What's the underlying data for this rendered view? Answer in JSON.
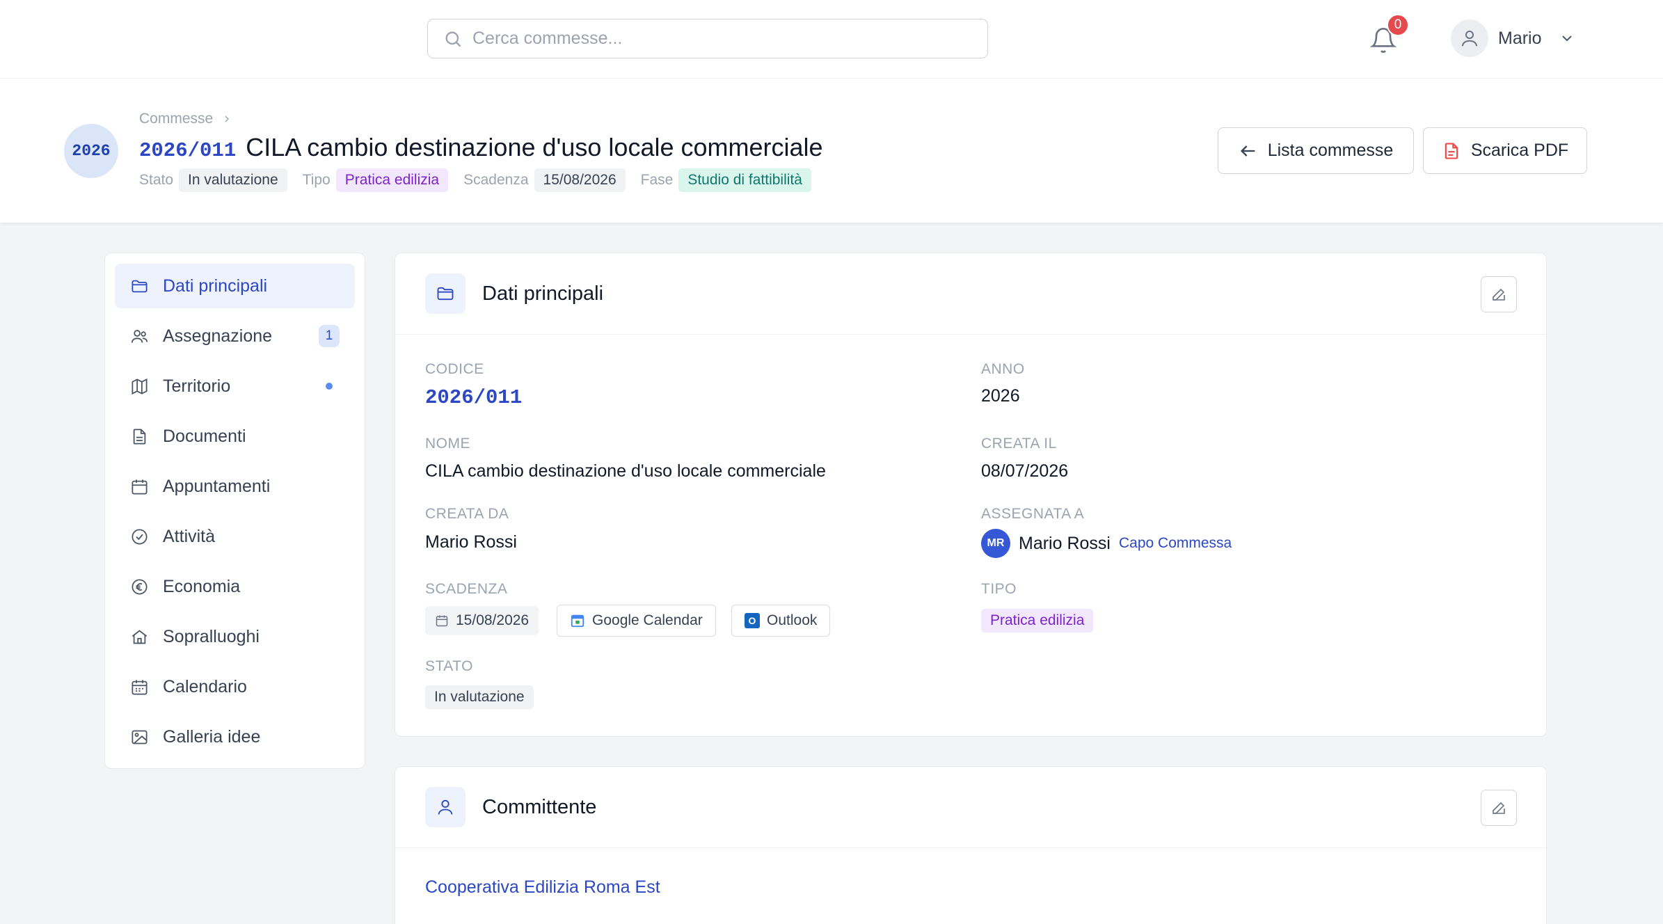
{
  "topbar": {
    "search_placeholder": "Cerca commesse...",
    "notifications_count": "0",
    "user_name": "Mario"
  },
  "header": {
    "year_badge": "2026",
    "breadcrumb": "Commesse",
    "code": "2026/011",
    "title": "CILA cambio destinazione d'uso locale commerciale",
    "meta": {
      "stato_label": "Stato",
      "stato_value": "In valutazione",
      "tipo_label": "Tipo",
      "tipo_value": "Pratica edilizia",
      "scadenza_label": "Scadenza",
      "scadenza_value": "15/08/2026",
      "fase_label": "Fase",
      "fase_value": "Studio di fattibilità"
    },
    "list_button": "Lista commesse",
    "pdf_button": "Scarica PDF"
  },
  "sidebar": {
    "items": [
      {
        "label": "Dati principali",
        "icon": "folder-icon"
      },
      {
        "label": "Assegnazione",
        "icon": "users-icon",
        "badge": "1"
      },
      {
        "label": "Territorio",
        "icon": "map-icon"
      },
      {
        "label": "Documenti",
        "icon": "document-icon"
      },
      {
        "label": "Appuntamenti",
        "icon": "calendar-icon"
      },
      {
        "label": "Attività",
        "icon": "check-circle-icon"
      },
      {
        "label": "Economia",
        "icon": "euro-icon"
      },
      {
        "label": "Sopralluoghi",
        "icon": "home-icon"
      },
      {
        "label": "Calendario",
        "icon": "calendar-grid-icon"
      },
      {
        "label": "Galleria idee",
        "icon": "image-icon"
      }
    ]
  },
  "main_card": {
    "title": "Dati principali",
    "codice_label": "CODICE",
    "codice_value": "2026/011",
    "anno_label": "ANNO",
    "anno_value": "2026",
    "nome_label": "NOME",
    "nome_value": "CILA cambio destinazione d'uso locale commerciale",
    "creata_il_label": "CREATA IL",
    "creata_il_value": "08/07/2026",
    "creata_da_label": "CREATA DA",
    "creata_da_value": "Mario Rossi",
    "assegnata_label": "ASSEGNATA A",
    "assegnata_initials": "MR",
    "assegnata_name": "Mario Rossi",
    "assegnata_role": "Capo Commessa",
    "scadenza_label": "SCADENZA",
    "scadenza_value": "15/08/2026",
    "google_calendar": "Google Calendar",
    "outlook": "Outlook",
    "outlook_icon_letter": "O",
    "tipo_label": "TIPO",
    "tipo_value": "Pratica edilizia",
    "stato_label": "STATO",
    "stato_value": "In valutazione"
  },
  "committente_card": {
    "title": "Committente",
    "name": "Cooperativa Edilizia Roma Est"
  },
  "colors": {
    "accent": "#2c47c4",
    "badge_red": "#e5484d",
    "purple": "#7e22ce",
    "teal": "#0f766e"
  }
}
